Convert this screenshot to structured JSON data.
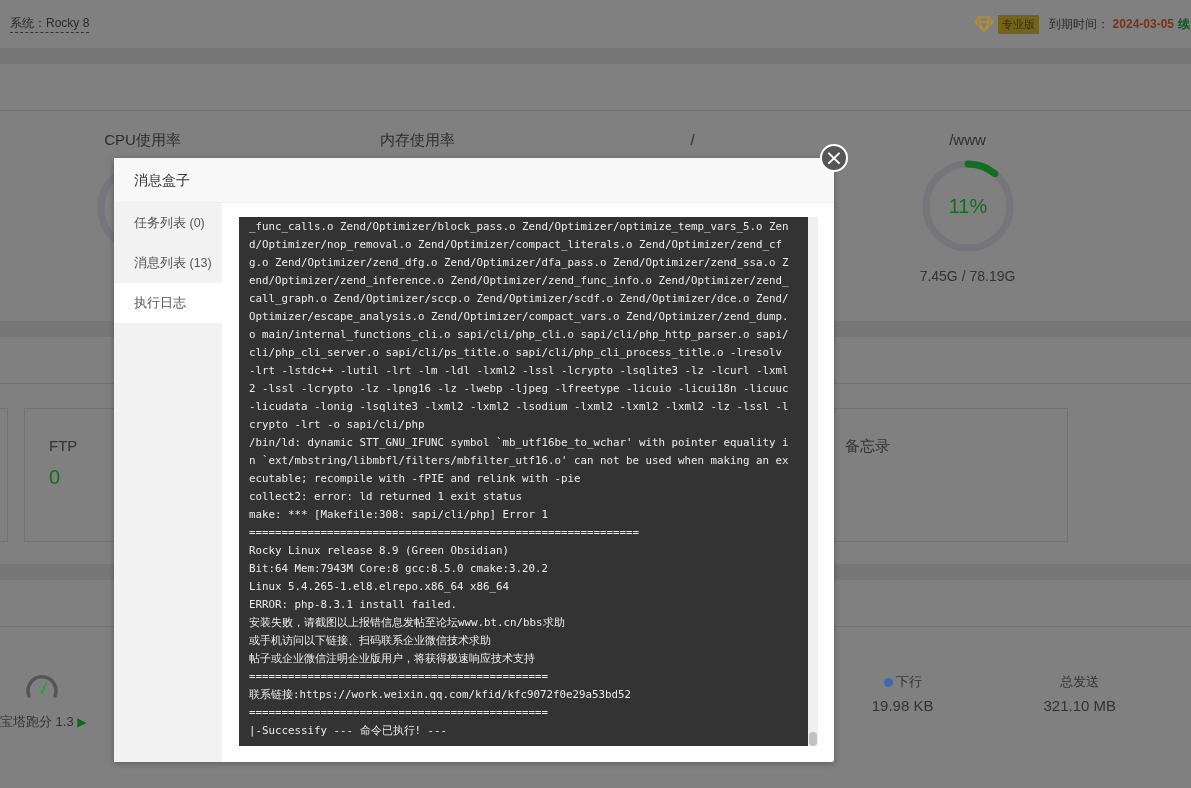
{
  "header": {
    "system": "系统：Rocky 8",
    "edition": "专业版",
    "expiry_label": "到期时间：",
    "expiry_date": "2024-03-05",
    "renew": "续"
  },
  "gauges": [
    {
      "title": "CPU使用率"
    },
    {
      "title": "内存使用率"
    },
    {
      "title": "/"
    },
    {
      "title": "/www",
      "value": "11%",
      "detail": "7.45G / 78.19G",
      "level": 0.11
    }
  ],
  "cards": [
    {
      "title": "FTP",
      "value": "0"
    },
    {
      "title": "备忘录"
    }
  ],
  "benchmark": {
    "label": "宝塔跑分 1.3",
    "play": "▶"
  },
  "traffic": [
    {
      "label": "下行",
      "value": "19.98 KB",
      "color": "#3d6aa8"
    },
    {
      "label": "总发送",
      "value": "321.10 MB"
    }
  ],
  "dialog": {
    "title": "消息盒子",
    "close": "×",
    "tabs": [
      {
        "label": "任务列表 (0)",
        "selected": false
      },
      {
        "label": "消息列表 (13)",
        "selected": false
      },
      {
        "label": "执行日志",
        "selected": true
      }
    ],
    "log": [
      "_func_calls.o Zend/Optimizer/block_pass.o Zend/Optimizer/optimize_temp_vars_5.o Zen",
      "d/Optimizer/nop_removal.o Zend/Optimizer/compact_literals.o Zend/Optimizer/zend_cf",
      "g.o Zend/Optimizer/zend_dfg.o Zend/Optimizer/dfa_pass.o Zend/Optimizer/zend_ssa.o Z",
      "end/Optimizer/zend_inference.o Zend/Optimizer/zend_func_info.o Zend/Optimizer/zend_",
      "call_graph.o Zend/Optimizer/sccp.o Zend/Optimizer/scdf.o Zend/Optimizer/dce.o Zend/",
      "Optimizer/escape_analysis.o Zend/Optimizer/compact_vars.o Zend/Optimizer/zend_dump.",
      "o main/internal_functions_cli.o sapi/cli/php_cli.o sapi/cli/php_http_parser.o sapi/",
      "cli/php_cli_server.o sapi/cli/ps_title.o sapi/cli/php_cli_process_title.o -lresolv",
      "-lrt -lstdc++ -lutil -lrt -lm -ldl -lxml2 -lssl -lcrypto -lsqlite3 -lz -lcurl -lxml",
      "2 -lssl -lcrypto -lz -lpng16 -lz -lwebp -ljpeg -lfreetype -licuio -licui18n -licuuc",
      "-licudata -lonig -lsqlite3 -lxml2 -lxml2 -lsodium -lxml2 -lxml2 -lxml2 -lz -lssl -l",
      "crypto -lrt -o sapi/cli/php",
      "/bin/ld: dynamic STT_GNU_IFUNC symbol `mb_utf16be_to_wchar' with pointer equality i",
      "n `ext/mbstring/libmbfl/filters/mbfilter_utf16.o' can not be used when making an ex",
      "ecutable; recompile with -fPIE and relink with -pie",
      "collect2: error: ld returned 1 exit status",
      "make: *** [Makefile:308: sapi/cli/php] Error 1",
      "============================================================",
      "Rocky Linux release 8.9 (Green Obsidian)",
      "Bit:64 Mem:7943M Core:8 gcc:8.5.0 cmake:3.20.2",
      "Linux 5.4.265-1.el8.elrepo.x86_64 x86_64",
      "ERROR: php-8.3.1 install failed.",
      "安装失败，请截图以上报错信息发帖至论坛www.bt.cn/bbs求助",
      "或手机访问以下链接、扫码联系企业微信技术求助",
      "帖子或企业微信注明企业版用户，将获得极速响应技术支持",
      "==============================================",
      "联系链接:https://work.weixin.qq.com/kfid/kfc9072f0e29a53bd52",
      "==============================================",
      "|-Successify --- 命令已执行! ---"
    ]
  }
}
